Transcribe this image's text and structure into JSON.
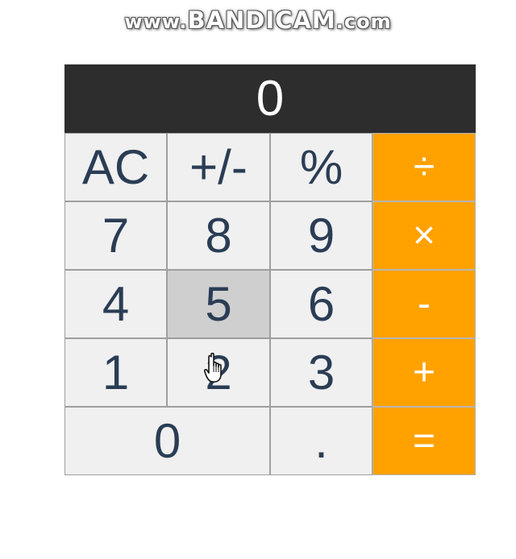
{
  "watermark": {
    "prefix": "www.",
    "brand": "BANDICAM",
    "suffix": ".com"
  },
  "display": {
    "value": "0"
  },
  "keys": [
    {
      "label": "AC",
      "name": "clear-button",
      "type": "function"
    },
    {
      "label": "+/-",
      "name": "toggle-sign-button",
      "type": "function"
    },
    {
      "label": "%",
      "name": "percent-button",
      "type": "function"
    },
    {
      "label": "÷",
      "name": "divide-button",
      "type": "operator"
    },
    {
      "label": "7",
      "name": "digit-7-button",
      "type": "digit"
    },
    {
      "label": "8",
      "name": "digit-8-button",
      "type": "digit"
    },
    {
      "label": "9",
      "name": "digit-9-button",
      "type": "digit"
    },
    {
      "label": "×",
      "name": "multiply-button",
      "type": "operator"
    },
    {
      "label": "4",
      "name": "digit-4-button",
      "type": "digit"
    },
    {
      "label": "5",
      "name": "digit-5-button",
      "type": "digit",
      "state": "pressed"
    },
    {
      "label": "6",
      "name": "digit-6-button",
      "type": "digit"
    },
    {
      "label": "-",
      "name": "subtract-button",
      "type": "operator"
    },
    {
      "label": "1",
      "name": "digit-1-button",
      "type": "digit"
    },
    {
      "label": "2",
      "name": "digit-2-button",
      "type": "digit"
    },
    {
      "label": "3",
      "name": "digit-3-button",
      "type": "digit"
    },
    {
      "label": "+",
      "name": "add-button",
      "type": "operator"
    },
    {
      "label": "0",
      "name": "digit-0-button",
      "type": "digit"
    },
    {
      "label": ".",
      "name": "decimal-button",
      "type": "digit"
    },
    {
      "label": "=",
      "name": "equals-button",
      "type": "operator"
    }
  ],
  "cursor": {
    "icon": "hand-pointer-icon"
  },
  "colors": {
    "display_bg": "#2d2d2d",
    "key_bg": "#f0f0f0",
    "key_pressed_bg": "#cfcfcf",
    "operator_bg": "#ffa200",
    "key_text": "#2a3d55"
  }
}
